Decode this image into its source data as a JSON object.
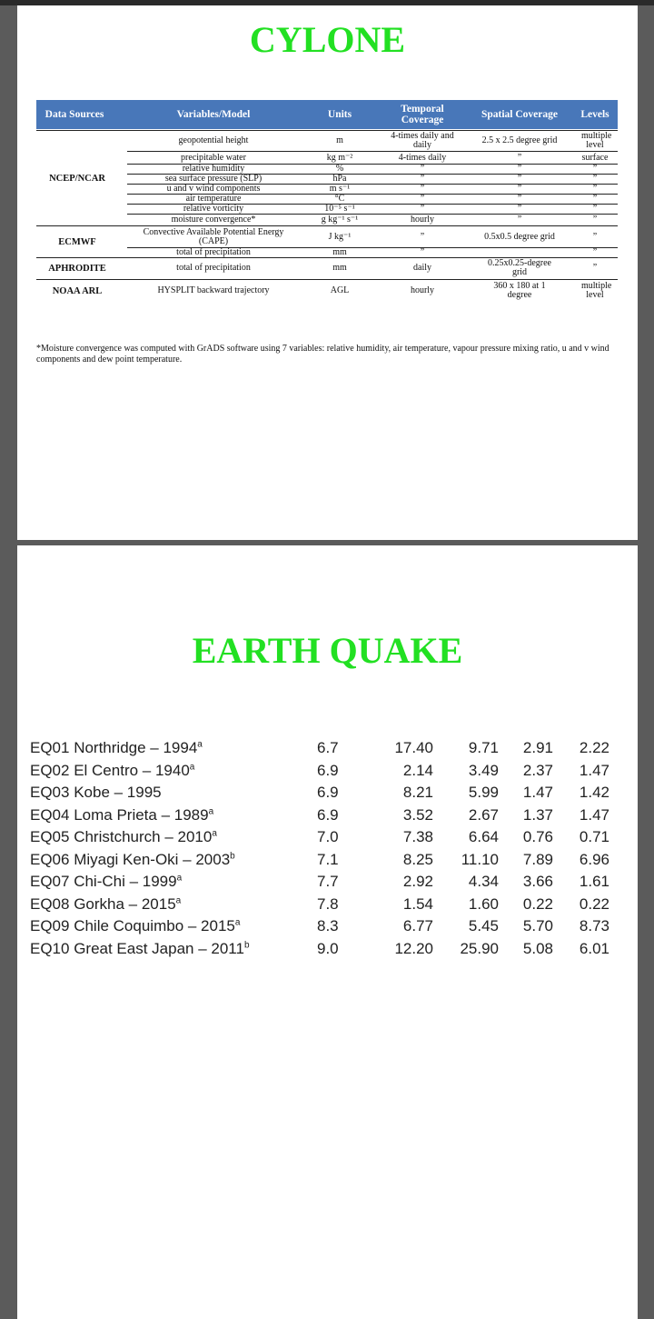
{
  "cyclone": {
    "heading": "CYLONE",
    "table": {
      "headers": [
        "Data Sources",
        "Variables/Model",
        "Units",
        "Temporal Coverage",
        "Spatial Coverage",
        "Levels"
      ],
      "sources": [
        "NCEP/NCAR",
        "ECMWF",
        "APHRODITE",
        "NOAA ARL"
      ],
      "rows": [
        [
          "geopotential height",
          "m",
          "4-times daily and daily",
          "2.5 x 2.5 degree grid",
          "multiple level"
        ],
        [
          "precipitable water",
          "kg m⁻²",
          "4-times daily",
          "”",
          "surface"
        ],
        [
          "relative humidity",
          "%",
          "”",
          "”",
          "”"
        ],
        [
          "sea surface pressure (SLP)",
          "hPa",
          "”",
          "”",
          "”"
        ],
        [
          "u and v wind components",
          "m s⁻¹",
          "”",
          "”",
          "”"
        ],
        [
          "air temperature",
          "°C",
          "”",
          "”",
          "”"
        ],
        [
          "relative vorticity",
          "10⁻⁵ s⁻¹",
          "”",
          "”",
          "”"
        ],
        [
          "moisture convergence*",
          "g kg⁻¹ s⁻¹",
          "hourly",
          "”",
          "”"
        ],
        [
          "Convective Available Potential Energy (CAPE)",
          "J kg⁻¹",
          "”",
          "0.5x0.5 degree grid",
          "”"
        ],
        [
          "total of precipitation",
          "mm",
          "”",
          "",
          "”"
        ],
        [
          "total of precipitation",
          "mm",
          "daily",
          "0.25x0.25-degree grid",
          "”"
        ],
        [
          "HYSPLIT backward trajectory",
          "AGL",
          "hourly",
          "360 x 180 at 1 degree",
          "multiple level"
        ]
      ],
      "footnote": "*Moisture convergence was computed with GrADS software using 7 variables: relative humidity, air temperature, vapour pressure mixing ratio, u and v wind components and dew point temperature."
    }
  },
  "earthquake": {
    "heading": "EARTH QUAKE",
    "rows": [
      {
        "name": "EQ01 Northridge – 1994",
        "sup": "a",
        "mag": "6.7",
        "v1": "17.40",
        "v2": "9.71",
        "v3": "2.91",
        "v4": "2.22"
      },
      {
        "name": "EQ02 El Centro – 1940",
        "sup": "a",
        "mag": "6.9",
        "v1": "2.14",
        "v2": "3.49",
        "v3": "2.37",
        "v4": "1.47"
      },
      {
        "name": "EQ03 Kobe – 1995",
        "sup": "",
        "mag": "6.9",
        "v1": "8.21",
        "v2": "5.99",
        "v3": "1.47",
        "v4": "1.42"
      },
      {
        "name": "EQ04 Loma Prieta – 1989",
        "sup": "a",
        "mag": "6.9",
        "v1": "3.52",
        "v2": "2.67",
        "v3": "1.37",
        "v4": "1.47"
      },
      {
        "name": "EQ05 Christchurch – 2010",
        "sup": "a",
        "mag": "7.0",
        "v1": "7.38",
        "v2": "6.64",
        "v3": "0.76",
        "v4": "0.71"
      },
      {
        "name": "EQ06 Miyagi Ken-Oki – 2003",
        "sup": "b",
        "mag": "7.1",
        "v1": "8.25",
        "v2": "11.10",
        "v3": "7.89",
        "v4": "6.96"
      },
      {
        "name": "EQ07 Chi-Chi – 1999",
        "sup": "a",
        "mag": "7.7",
        "v1": "2.92",
        "v2": "4.34",
        "v3": "3.66",
        "v4": "1.61"
      },
      {
        "name": "EQ08 Gorkha – 2015",
        "sup": "a",
        "mag": "7.8",
        "v1": "1.54",
        "v2": "1.60",
        "v3": "0.22",
        "v4": "0.22"
      },
      {
        "name": "EQ09 Chile Coquimbo – 2015",
        "sup": "a",
        "mag": "8.3",
        "v1": "6.77",
        "v2": "5.45",
        "v3": "5.70",
        "v4": "8.73"
      },
      {
        "name": "EQ10 Great East Japan – 2011",
        "sup": "b",
        "mag": "9.0",
        "v1": "12.20",
        "v2": "25.90",
        "v3": "5.08",
        "v4": "6.01"
      }
    ]
  },
  "colors": {
    "heading": "#22e022",
    "table_header": "#4877b9"
  }
}
